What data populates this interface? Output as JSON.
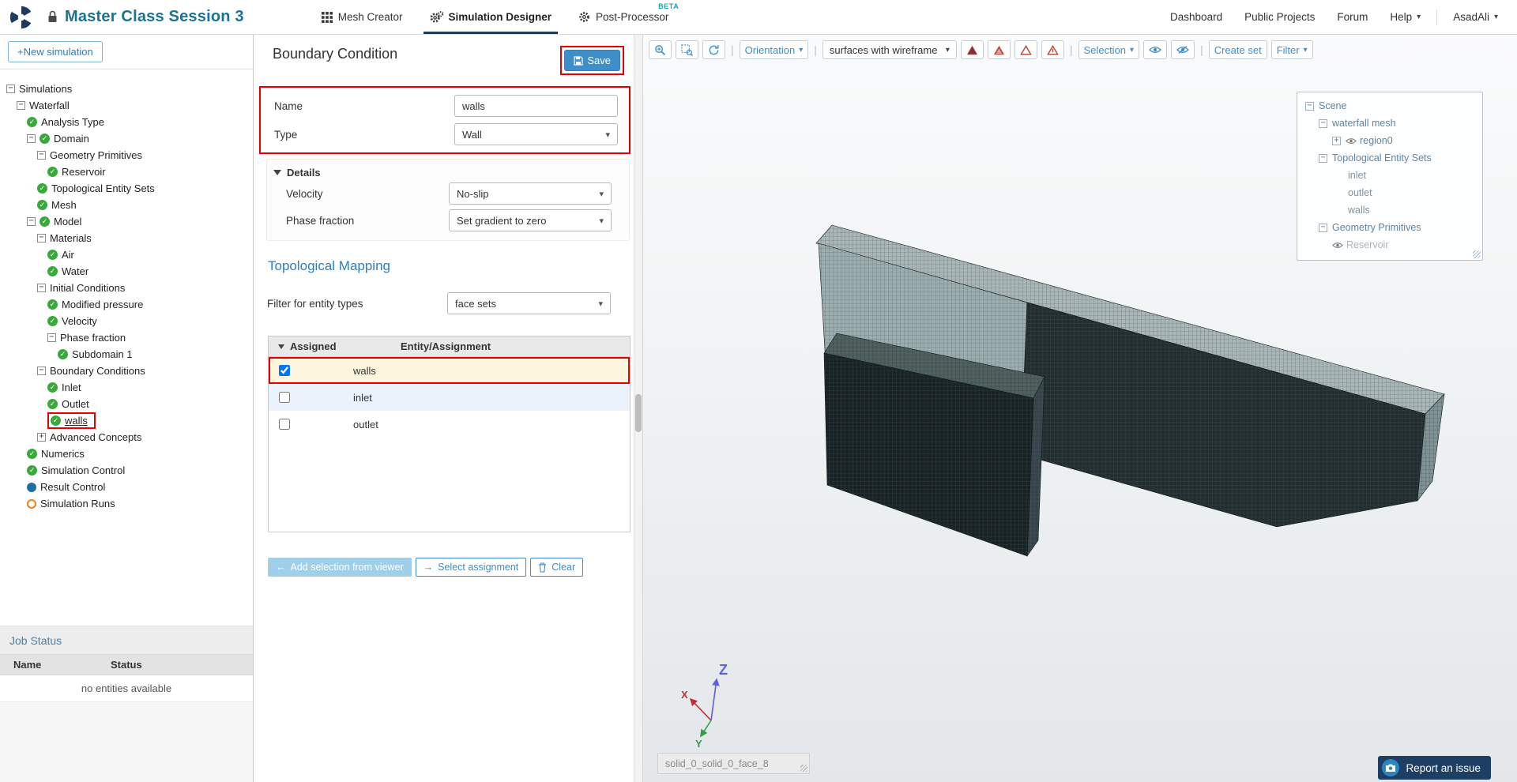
{
  "header": {
    "title": "Master Class Session 3",
    "tabs": [
      {
        "label": "Mesh Creator",
        "icon": "grid",
        "active": false
      },
      {
        "label": "Simulation Designer",
        "icon": "gears",
        "active": true
      },
      {
        "label": "Post-Processor",
        "icon": "gear",
        "active": false,
        "badge": "BETA"
      }
    ],
    "nav": [
      "Dashboard",
      "Public Projects",
      "Forum"
    ],
    "help": "Help",
    "user": "AsadAli"
  },
  "icons": {
    "caret_down": "▾",
    "collapse": "−",
    "expand": "+",
    "check": "✓",
    "arrow_left": "←",
    "arrow_right": "→"
  },
  "sidebar": {
    "new_simulation": "+New simulation",
    "tree": [
      {
        "label": "Simulations",
        "depth": 0,
        "expander": "minus",
        "icon": "none"
      },
      {
        "label": "Waterfall",
        "depth": 1,
        "expander": "minus",
        "icon": "none"
      },
      {
        "label": "Analysis Type",
        "depth": 2,
        "expander": "none",
        "icon": "check"
      },
      {
        "label": "Domain",
        "depth": 2,
        "expander": "minus",
        "icon": "check"
      },
      {
        "label": "Geometry Primitives",
        "depth": 3,
        "expander": "minus",
        "icon": "none"
      },
      {
        "label": "Reservoir",
        "depth": 4,
        "expander": "none",
        "icon": "check"
      },
      {
        "label": "Topological Entity Sets",
        "depth": 3,
        "expander": "none",
        "icon": "check"
      },
      {
        "label": "Mesh",
        "depth": 3,
        "expander": "none",
        "icon": "check"
      },
      {
        "label": "Model",
        "depth": 2,
        "expander": "minus",
        "icon": "check"
      },
      {
        "label": "Materials",
        "depth": 3,
        "expander": "minus",
        "icon": "none"
      },
      {
        "label": "Air",
        "depth": 4,
        "expander": "none",
        "icon": "check"
      },
      {
        "label": "Water",
        "depth": 4,
        "expander": "none",
        "icon": "check"
      },
      {
        "label": "Initial Conditions",
        "depth": 3,
        "expander": "minus",
        "icon": "none"
      },
      {
        "label": "Modified pressure",
        "depth": 4,
        "expander": "none",
        "icon": "check"
      },
      {
        "label": "Velocity",
        "depth": 4,
        "expander": "none",
        "icon": "check"
      },
      {
        "label": "Phase fraction",
        "depth": 4,
        "expander": "minus",
        "icon": "none"
      },
      {
        "label": "Subdomain 1",
        "depth": 5,
        "expander": "none",
        "icon": "check"
      },
      {
        "label": "Boundary Conditions",
        "depth": 3,
        "expander": "minus",
        "icon": "none"
      },
      {
        "label": "Inlet",
        "depth": 4,
        "expander": "none",
        "icon": "check"
      },
      {
        "label": "Outlet",
        "depth": 4,
        "expander": "none",
        "icon": "check"
      },
      {
        "label": "walls",
        "depth": 4,
        "expander": "none",
        "icon": "check",
        "highlighted": true
      },
      {
        "label": "Advanced Concepts",
        "depth": 3,
        "expander": "plus",
        "icon": "none"
      },
      {
        "label": "Numerics",
        "depth": 2,
        "expander": "none",
        "icon": "check"
      },
      {
        "label": "Simulation Control",
        "depth": 2,
        "expander": "none",
        "icon": "check"
      },
      {
        "label": "Result Control",
        "depth": 2,
        "expander": "none",
        "icon": "dot"
      },
      {
        "label": "Simulation Runs",
        "depth": 2,
        "expander": "none",
        "icon": "circle"
      }
    ],
    "job_status": {
      "title": "Job Status",
      "columns": [
        "Name",
        "Status"
      ],
      "empty_text": "no entities available"
    }
  },
  "panel": {
    "title": "Boundary Condition",
    "save_label": "Save",
    "fields": {
      "name_label": "Name",
      "name_value": "walls",
      "type_label": "Type",
      "type_value": "Wall"
    },
    "details": {
      "title": "Details",
      "velocity_label": "Velocity",
      "velocity_value": "No-slip",
      "phase_label": "Phase fraction",
      "phase_value": "Set gradient to zero"
    },
    "mapping": {
      "title": "Topological Mapping",
      "filter_label": "Filter for entity types",
      "filter_value": "face sets",
      "table": {
        "col1": "Assigned",
        "col2": "Entity/Assignment",
        "rows": [
          {
            "label": "walls",
            "checked": true,
            "highlight": true
          },
          {
            "label": "inlet",
            "checked": false
          },
          {
            "label": "outlet",
            "checked": false
          }
        ]
      },
      "buttons": {
        "add": "Add selection from viewer",
        "select": "Select assignment",
        "clear": "Clear"
      }
    }
  },
  "viewer": {
    "toolbar": {
      "orientation": "Orientation",
      "render_mode": "surfaces with wireframe",
      "selection": "Selection",
      "create_set": "Create set",
      "filter": "Filter"
    },
    "scene_tree": [
      {
        "label": "Scene",
        "depth": 0,
        "expander": "minus"
      },
      {
        "label": "waterfall mesh",
        "depth": 1,
        "expander": "minus"
      },
      {
        "label": "region0",
        "depth": 2,
        "expander": "plus",
        "eye": true
      },
      {
        "label": "Topological Entity Sets",
        "depth": 1,
        "expander": "minus"
      },
      {
        "label": "inlet",
        "depth": 2
      },
      {
        "label": "outlet",
        "depth": 2
      },
      {
        "label": "walls",
        "depth": 2
      },
      {
        "label": "Geometry Primitives",
        "depth": 1,
        "expander": "minus"
      },
      {
        "label": "Reservoir",
        "depth": 2,
        "eye": true,
        "muted": true
      }
    ],
    "axis": {
      "x": "X",
      "y": "Y",
      "z": "Z"
    },
    "tooltip": "solid_0_solid_0_face_8",
    "report_issue": "Report an issue"
  }
}
